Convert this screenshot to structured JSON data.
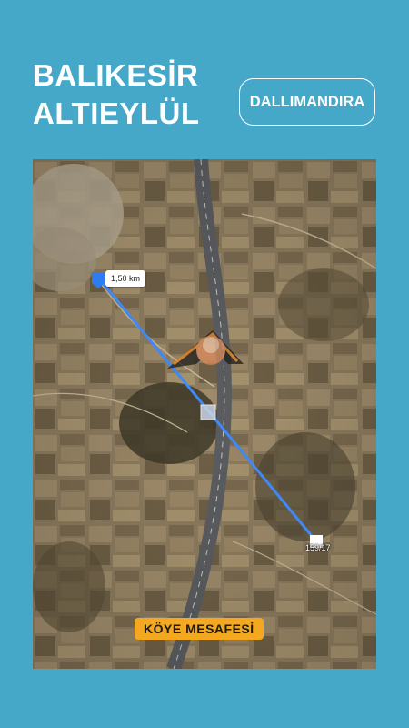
{
  "header": {
    "title_line1": "BALIKESİR",
    "title_line2": "ALTIEYLÜL",
    "district": "DALLIMANDIRA"
  },
  "map": {
    "distance_label": "1,50 km",
    "parcel_label": "159/17",
    "badge": "KÖYE MESAFESİ",
    "route_color": "#3f88f5"
  },
  "colors": {
    "background": "#46a8c8",
    "badge": "#f3a81f"
  }
}
